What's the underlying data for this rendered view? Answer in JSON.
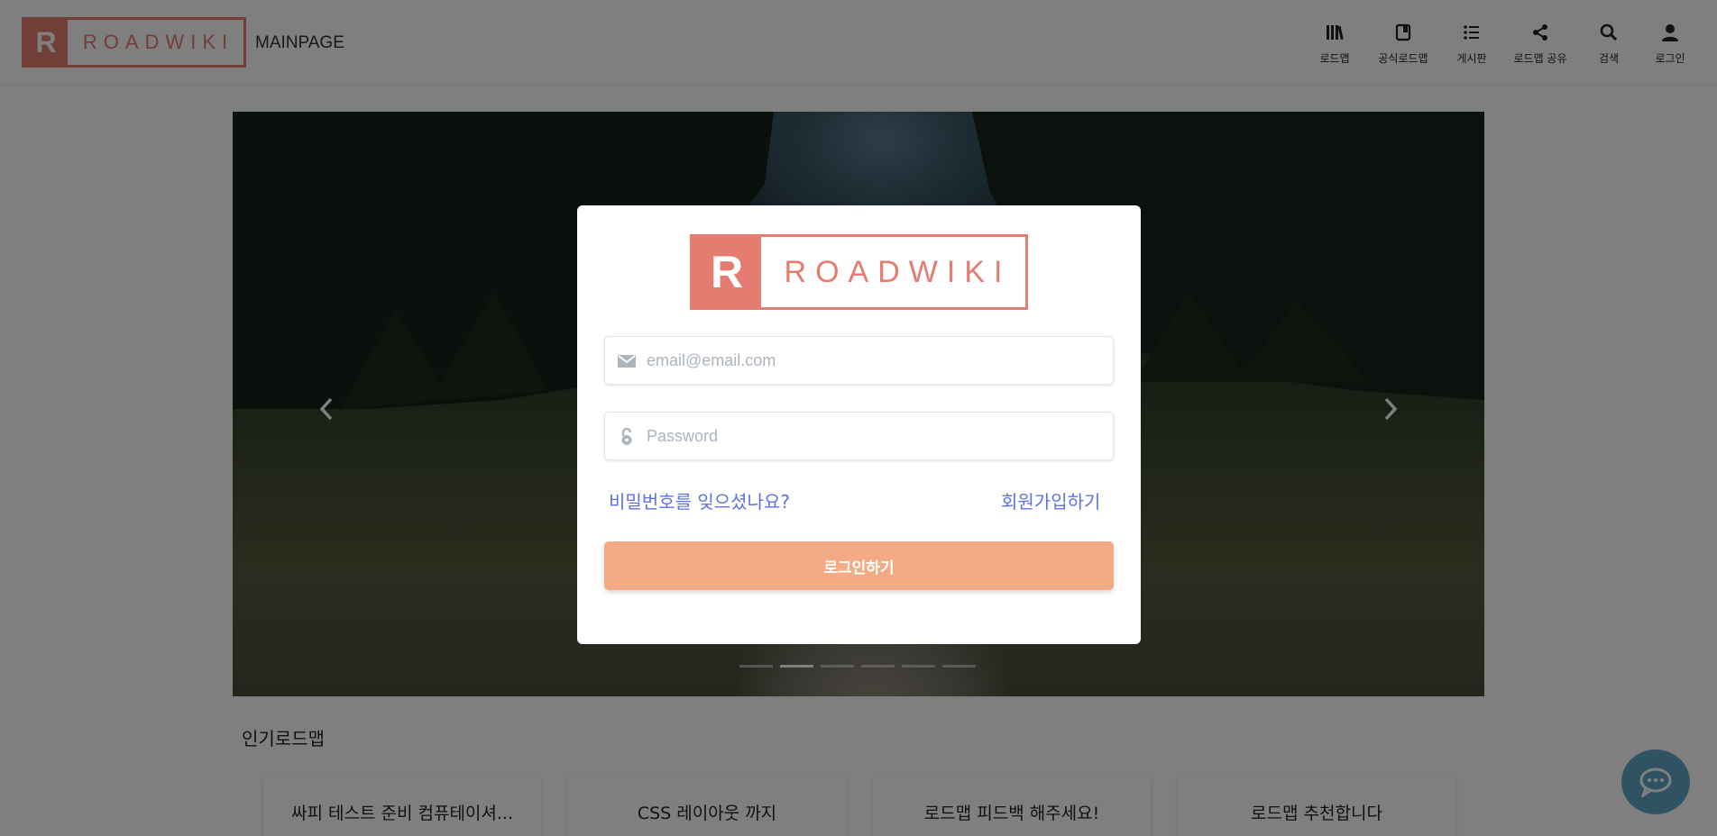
{
  "header": {
    "logo_letter": "R",
    "logo_text": "ROADWIKI",
    "page_label": "MAINPAGE",
    "nav": [
      {
        "label": "로드맵",
        "icon": "roadmap-icon"
      },
      {
        "label": "공식로드맵",
        "icon": "official-roadmap-icon"
      },
      {
        "label": "게시판",
        "icon": "list-icon"
      },
      {
        "label": "로드맵 공유",
        "icon": "share-icon"
      },
      {
        "label": "검색",
        "icon": "search-icon"
      },
      {
        "label": "로그인",
        "icon": "user-icon"
      }
    ]
  },
  "carousel": {
    "slide_count": 6,
    "active_index": 1
  },
  "popular": {
    "title": "인기로드맵",
    "cards": [
      {
        "title": "싸피 테스트 준비 컴퓨테이셔..."
      },
      {
        "title": "CSS 레이아웃 까지"
      },
      {
        "title": "로드맵 피드백 해주세요!"
      },
      {
        "title": "로드맵 추천합니다"
      }
    ]
  },
  "login_modal": {
    "logo_letter": "R",
    "logo_text": "ROADWIKI",
    "email": {
      "placeholder": "email@email.com",
      "value": ""
    },
    "password": {
      "placeholder": "Password",
      "value": ""
    },
    "forgot_password": "비밀번호를 잊으셨나요?",
    "signup": "회원가입하기",
    "submit": "로그인하기"
  },
  "colors": {
    "brand": "#e57c71",
    "button": "#f4ab85",
    "link": "#5e72e4",
    "chat": "#5fa7c6"
  }
}
